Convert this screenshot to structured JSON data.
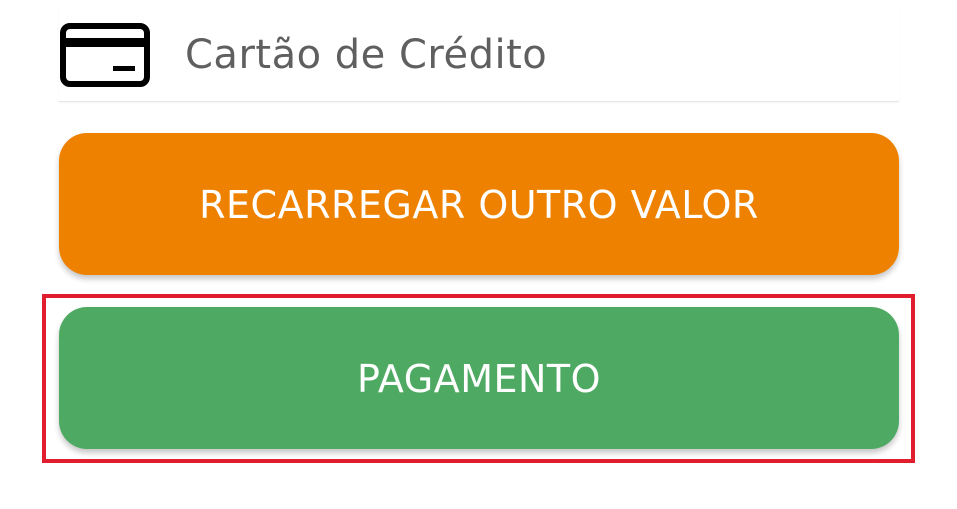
{
  "payment_method": {
    "icon": "credit-card-icon",
    "label": "Cartão de Crédito"
  },
  "buttons": {
    "recharge_label": "RECARREGAR OUTRO VALOR",
    "payment_label": "PAGAMENTO"
  },
  "colors": {
    "recharge_button": "#ee8200",
    "payment_button": "#4eaa63",
    "highlight_border": "#e01e2d",
    "label_text": "#5f5f5f"
  }
}
